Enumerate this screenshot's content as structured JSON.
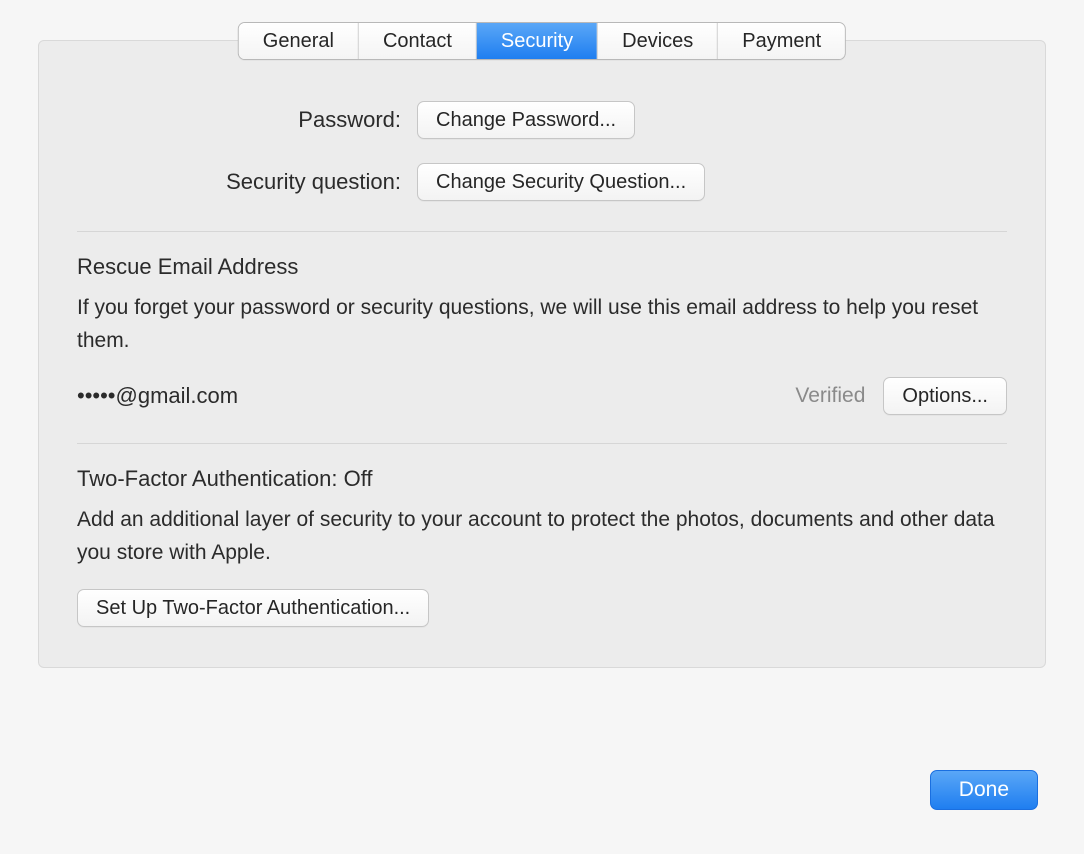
{
  "tabs": {
    "general": "General",
    "contact": "Contact",
    "security": "Security",
    "devices": "Devices",
    "payment": "Payment"
  },
  "password": {
    "label": "Password:",
    "button": "Change Password..."
  },
  "security_question": {
    "label": "Security question:",
    "button": "Change Security Question..."
  },
  "rescue": {
    "heading": "Rescue Email Address",
    "description": "If you forget your password or security questions, we will use this email address to help you reset them.",
    "email": "•••••@gmail.com",
    "status": "Verified",
    "options_button": "Options..."
  },
  "two_factor": {
    "heading": "Two-Factor Authentication: Off",
    "description": "Add an additional layer of security to your account to protect the photos, documents and other data you store with Apple.",
    "button": "Set Up Two-Factor Authentication..."
  },
  "footer": {
    "done": "Done"
  }
}
